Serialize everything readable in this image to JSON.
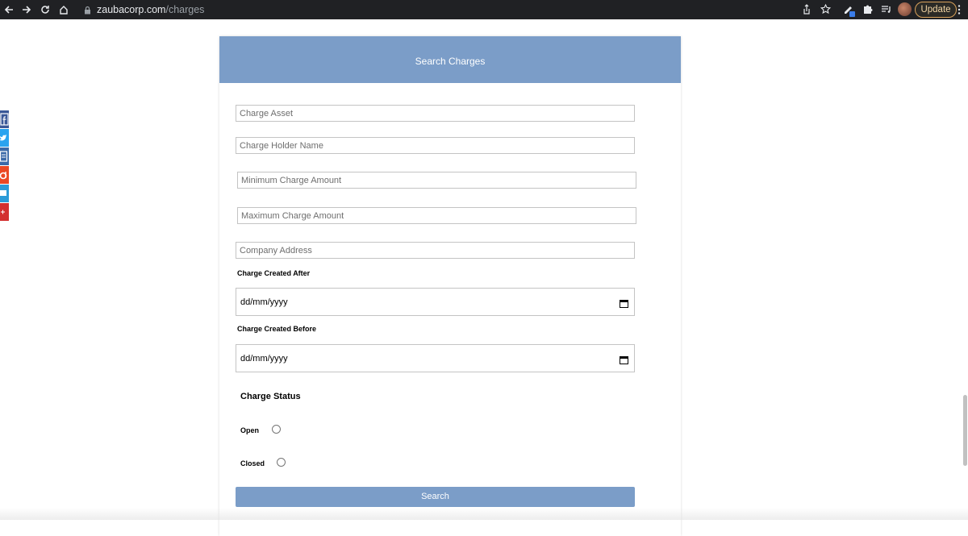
{
  "browser": {
    "url_domain": "zaubacorp.com",
    "url_path": "/charges",
    "update_label": "Update"
  },
  "social": [
    {
      "name": "facebook",
      "color": "#3b5998",
      "glyph": "f"
    },
    {
      "name": "twitter",
      "color": "#2aa3ef",
      "glyph": "t"
    },
    {
      "name": "print",
      "color": "#3b6aa8",
      "glyph": "p"
    },
    {
      "name": "stumbleupon",
      "color": "#eb4924",
      "glyph": "s"
    },
    {
      "name": "email",
      "color": "#2b9bd8",
      "glyph": "e"
    },
    {
      "name": "more",
      "color": "#d32f2f",
      "glyph": "+"
    }
  ],
  "form": {
    "title": "Search Charges",
    "charge_asset_placeholder": "Charge Asset",
    "holder_name_placeholder": "Charge Holder Name",
    "min_amount_placeholder": "Minimum Charge Amount",
    "max_amount_placeholder": "Maximum Charge Amount",
    "company_address_placeholder": "Company Address",
    "created_after_label": "Charge Created After",
    "created_after_value": "dd/mm/yyyy",
    "created_before_label": "Charge Created Before",
    "created_before_value": "dd/mm/yyyy",
    "status_title": "Charge Status",
    "status_open_label": "Open",
    "status_closed_label": "Closed",
    "search_label": "Search"
  },
  "colors": {
    "accent": "#7b9dc8",
    "chrome": "#202124"
  }
}
